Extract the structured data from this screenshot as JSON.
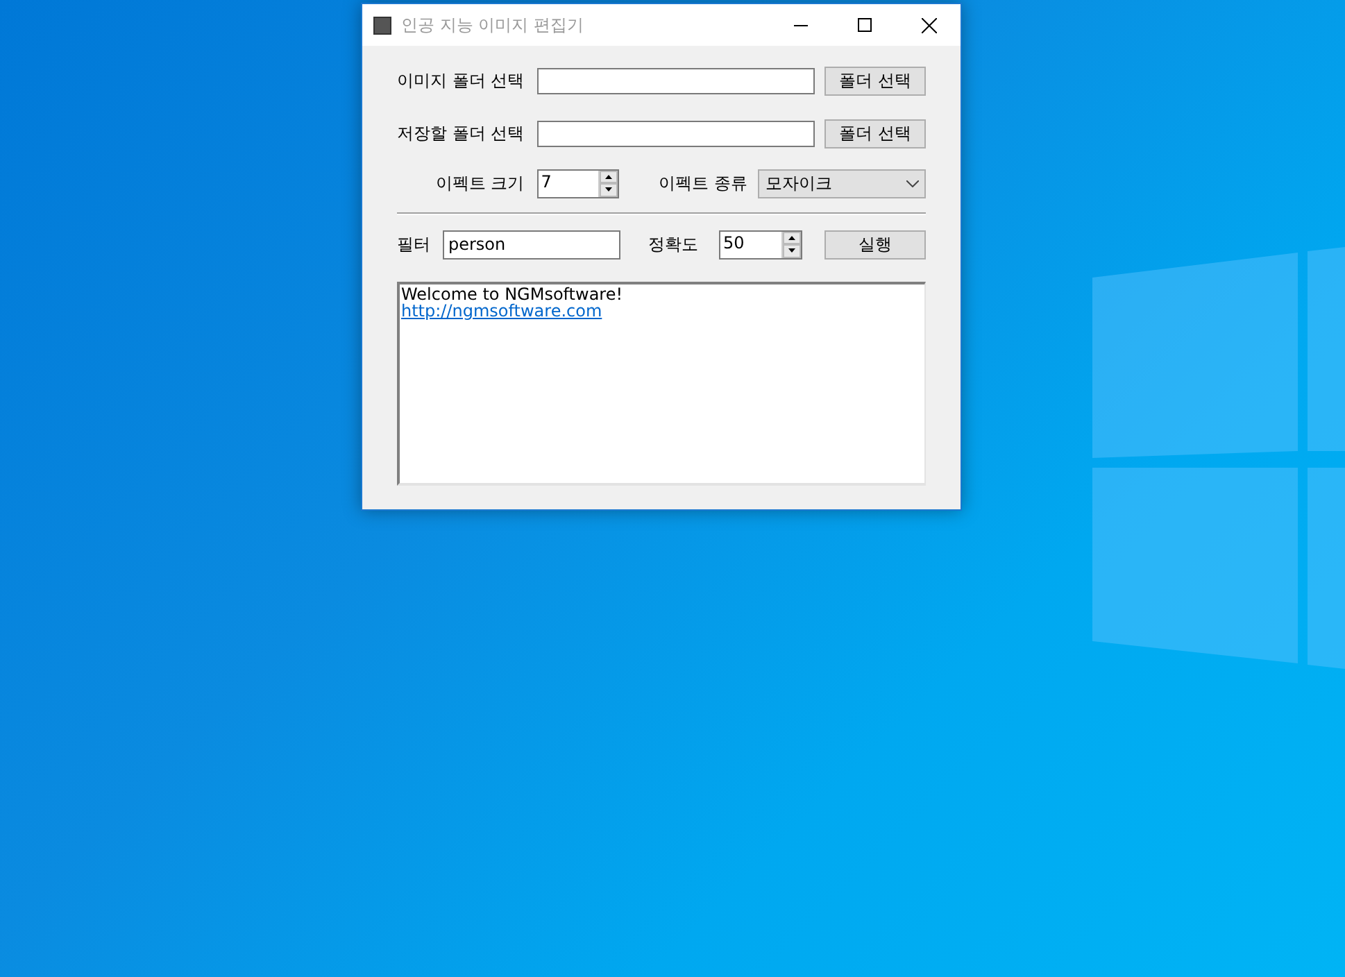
{
  "window": {
    "title": "인공 지능 이미지 편집기"
  },
  "folder_rows": [
    {
      "label": "이미지 폴더 선택",
      "value": "",
      "button": "폴더 선택"
    },
    {
      "label": "저장할 폴더 선택",
      "value": "",
      "button": "폴더 선택"
    }
  ],
  "effect": {
    "size_label": "이펙트 크기",
    "size_value": "7",
    "type_label": "이펙트 종류",
    "type_value": "모자이크"
  },
  "filter": {
    "label": "필터",
    "value": "person",
    "accuracy_label": "정확도",
    "accuracy_value": "50",
    "run_button": "실행"
  },
  "log": [
    {
      "kind": "text",
      "text": "Welcome to NGMsoftware!"
    },
    {
      "kind": "link",
      "text": "http://ngmsoftware.com"
    }
  ]
}
